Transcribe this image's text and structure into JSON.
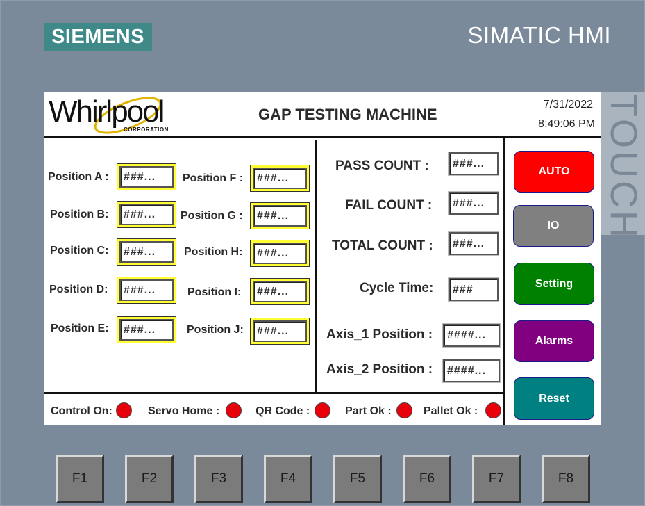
{
  "bezel": {
    "brand_logo": "SIEMENS",
    "product_label": "SIMATIC HMI",
    "touch_label": "TOUCH",
    "function_keys": [
      "F1",
      "F2",
      "F3",
      "F4",
      "F5",
      "F6",
      "F7",
      "F8"
    ]
  },
  "header": {
    "logo_text": "Whirlpool",
    "logo_subtext": "CORPORATION",
    "title": "GAP TESTING MACHINE",
    "date": "7/31/2022",
    "time": "8:49:06 PM"
  },
  "positions": {
    "left": [
      {
        "label": "Position A :",
        "value": "###..."
      },
      {
        "label": "Position B:",
        "value": "###..."
      },
      {
        "label": "Position C:",
        "value": "###..."
      },
      {
        "label": "Position D:",
        "value": "###..."
      },
      {
        "label": "Position E:",
        "value": "###..."
      }
    ],
    "right": [
      {
        "label": "Position F :",
        "value": "###..."
      },
      {
        "label": "Position G :",
        "value": "###..."
      },
      {
        "label": "Position H:",
        "value": "###..."
      },
      {
        "label": "Position I:",
        "value": "###..."
      },
      {
        "label": "Position J:",
        "value": "###..."
      }
    ]
  },
  "counts": {
    "pass": {
      "label": "PASS COUNT :",
      "value": "###..."
    },
    "fail": {
      "label": "FAIL COUNT :",
      "value": "###..."
    },
    "total": {
      "label": "TOTAL COUNT :",
      "value": "###..."
    },
    "cycle": {
      "label": "Cycle Time:",
      "value": "###"
    },
    "axis1": {
      "label": "Axis_1 Position :",
      "value": "####..."
    },
    "axis2": {
      "label": "Axis_2 Position :",
      "value": "####..."
    }
  },
  "status": [
    {
      "label": "Control On:",
      "state": "off"
    },
    {
      "label": "Servo Home :",
      "state": "off"
    },
    {
      "label": "QR Code :",
      "state": "off"
    },
    {
      "label": "Part Ok :",
      "state": "off"
    },
    {
      "label": "Pallet Ok :",
      "state": "off"
    }
  ],
  "buttons": {
    "auto": {
      "label": "AUTO",
      "color": "#ff0000"
    },
    "io": {
      "label": "IO",
      "color": "#808080"
    },
    "setting": {
      "label": "Setting",
      "color": "#008000"
    },
    "alarms": {
      "label": "Alarms",
      "color": "#800080"
    },
    "reset": {
      "label": "Reset",
      "color": "#008080"
    }
  },
  "colors": {
    "bezel": "#7a8a9b",
    "siemens_teal": "#3f8a88",
    "io_field_frame": "#ffff33",
    "led_off": "#e8000a",
    "swoosh": "#e0b400"
  }
}
